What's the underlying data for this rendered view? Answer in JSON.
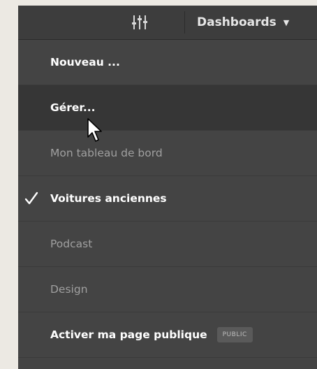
{
  "header": {
    "filter_icon": "sliders-icon",
    "dashboards_label": "Dashboards",
    "caret_icon": "caret-down-icon"
  },
  "menu": {
    "items": [
      {
        "label": "Nouveau ...",
        "style": "strong"
      },
      {
        "label": "Gérer...",
        "style": "strong",
        "hovered": true
      },
      {
        "label": "Mon tableau de bord",
        "style": "muted"
      },
      {
        "label": "Voitures anciennes",
        "style": "strong",
        "checked": true
      },
      {
        "label": "Podcast",
        "style": "muted"
      },
      {
        "label": "Design",
        "style": "muted"
      },
      {
        "label": "Activer ma page publique",
        "style": "strong",
        "badge": "PUBLIC"
      }
    ]
  },
  "colors": {
    "page_bg": "#ece9e3",
    "panel_bg": "#444444",
    "topbar_bg": "#3d3d3d",
    "hover_bg": "#363636",
    "text_strong": "#ffffff",
    "text_muted": "#a0a0a0"
  }
}
